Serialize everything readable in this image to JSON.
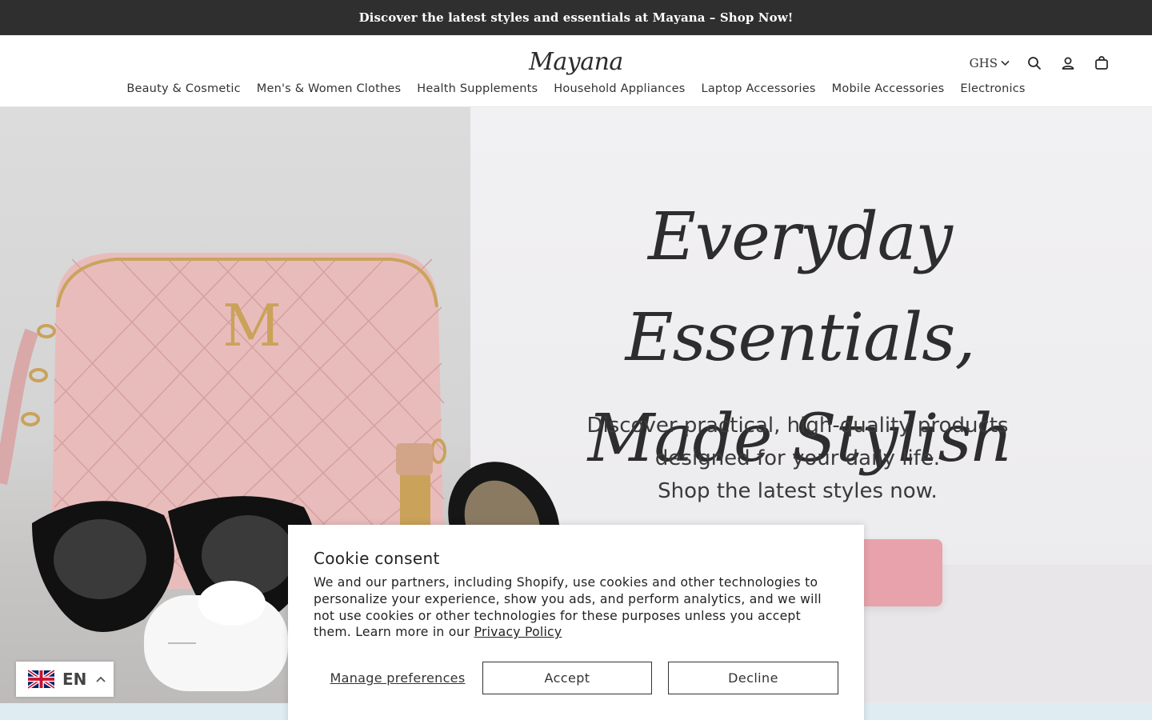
{
  "announcement": {
    "text": "Discover the latest styles and essentials at Mayana – Shop Now!"
  },
  "header": {
    "logo": "Mayana",
    "currency": "GHS",
    "icons": [
      "search-icon",
      "account-icon",
      "cart-icon"
    ]
  },
  "nav": {
    "items": [
      {
        "label": "Beauty & Cosmetic"
      },
      {
        "label": "Men's & Women Clothes"
      },
      {
        "label": "Health Supplements"
      },
      {
        "label": "Household Appliances"
      },
      {
        "label": "Laptop Accessories"
      },
      {
        "label": "Mobile Accessories"
      },
      {
        "label": "Electronics"
      }
    ]
  },
  "hero": {
    "title_line1": "Everyday Essentials,",
    "title_line2": "Made Stylish",
    "sub_line1": "Discover practical, high-quality products",
    "sub_line2": "designed for your daily life.",
    "sub_line3": "Shop the latest styles now.",
    "bag_monogram": "M"
  },
  "cookie": {
    "title": "Cookie consent",
    "body": "We and our partners, including Shopify, use cookies and other technologies to personalize your experience, show you ads, and perform analytics, and we will not use cookies or other technologies for these purposes unless you accept them. Learn more in our ",
    "privacy_link": "Privacy Policy",
    "manage_label": "Manage preferences",
    "accept_label": "Accept",
    "decline_label": "Decline"
  },
  "language": {
    "code": "EN",
    "flag": "uk-flag-icon"
  },
  "colors": {
    "announcement_bg": "#2f2f2f",
    "cta_pink": "#e8a2ab",
    "bag_pink": "#e9bcbc",
    "bottom_strip": "#dfedf3"
  }
}
